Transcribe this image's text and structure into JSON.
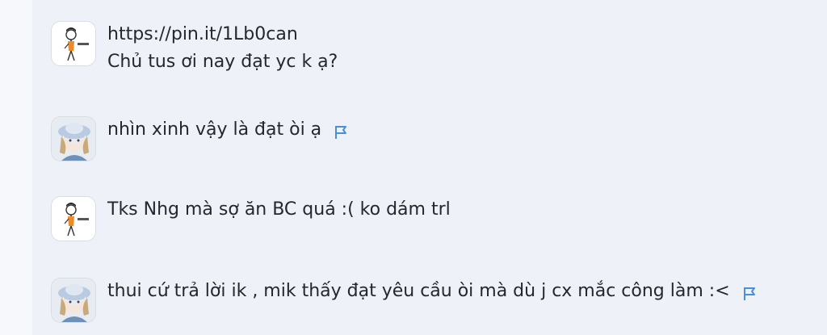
{
  "comments": [
    {
      "avatar": "stick-figure-avatar",
      "lines": [
        "https://pin.it/1Lb0can",
        "Chủ tus ơi nay đạt yc k ạ?"
      ]
    },
    {
      "avatar": "anime-avatar",
      "text": "nhìn xinh vậy là đạt òi ạ",
      "flag_icon": "flag-icon"
    },
    {
      "avatar": "stick-figure-avatar",
      "text": "Tks Nhg mà sợ ăn BC quá :( ko dám trl"
    },
    {
      "avatar": "anime-avatar",
      "text": "thui cứ trả lời ik , mik thấy đạt yêu cầu òi mà dù j cx mắc công làm :<",
      "flag_icon": "flag-icon"
    }
  ],
  "colors": {
    "background": "#eef2f8",
    "text": "#24272c",
    "flag": "#4a90d9"
  }
}
